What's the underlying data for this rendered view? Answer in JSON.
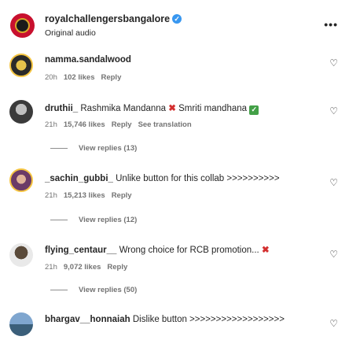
{
  "header": {
    "username": "royalchallengersbangalore",
    "subtitle": "Original audio",
    "more_icon": "more-horizontal-icon"
  },
  "comments": [
    {
      "username": "namma.sandalwood",
      "text": "",
      "time": "20h",
      "likes": "102 likes",
      "reply": "Reply"
    },
    {
      "username": "druthii_",
      "text_a": "Rashmika Mandanna",
      "text_b": "Smriti mandhana",
      "time": "21h",
      "likes": "15,746 likes",
      "reply": "Reply",
      "translation": "See translation",
      "view_replies": "View replies (13)"
    },
    {
      "username": "_sachin_gubbi_",
      "text": "Unlike button for this collab >>>>>>>>>>",
      "time": "21h",
      "likes": "15,213 likes",
      "reply": "Reply",
      "view_replies": "View replies (12)"
    },
    {
      "username": "flying_centaur__",
      "text": "Wrong choice for RCB promotion...",
      "time": "21h",
      "likes": "9,072 likes",
      "reply": "Reply",
      "view_replies": "View replies (50)"
    },
    {
      "username": "bhargav__honnaiah",
      "text": "Dislike button >>>>>>>>>>>>>>>>>>"
    }
  ],
  "colors": {
    "accent_red": "#c8102e",
    "verified_blue": "#3897f0",
    "meta_gray": "#737373"
  }
}
